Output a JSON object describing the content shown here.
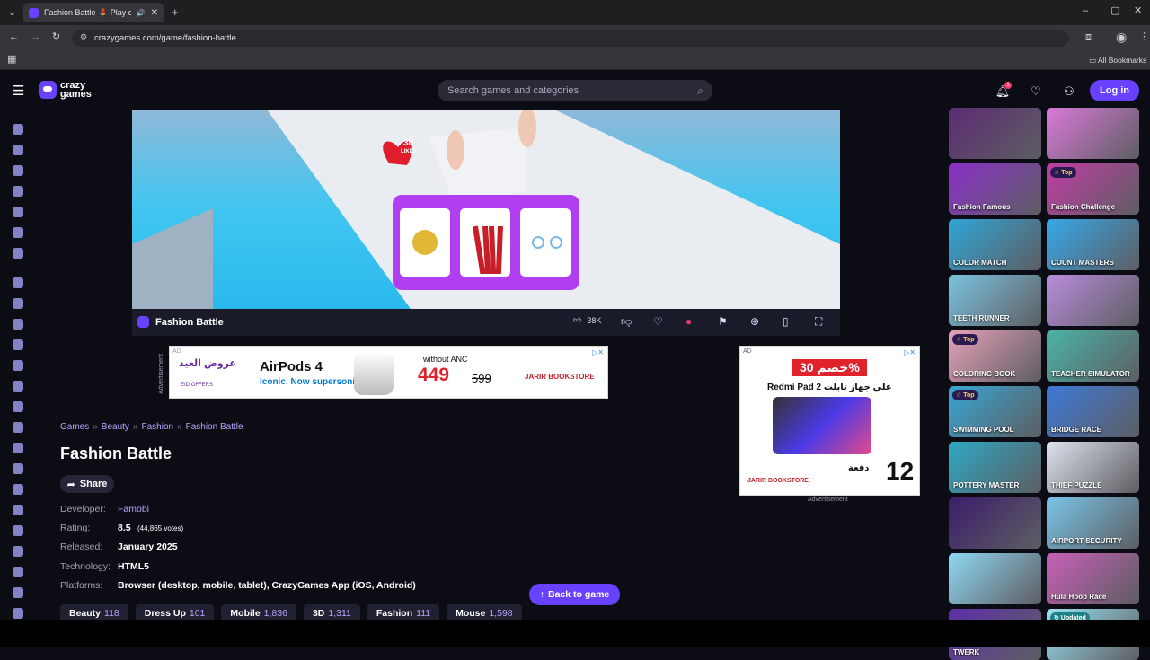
{
  "browser": {
    "tab_title": "Fashion Battle 💄 Play on C",
    "url": "crazygames.com/game/fashion-battle",
    "bookmarks_label": "All Bookmarks"
  },
  "site": {
    "logo_text_1": "crazy",
    "logo_text_2": "games",
    "search_placeholder": "Search games and categories",
    "login_label": "Log in",
    "notification_count": "1"
  },
  "game": {
    "name": "Fashion Battle",
    "likes_bubble": "38",
    "likes_bubble_label": "LIKES",
    "like_count": "38K"
  },
  "ads": {
    "ad_label": "AD",
    "ad1": {
      "brand": "AirPods 4",
      "tag": "Iconic. Now supersonic.",
      "note": "without ANC",
      "price": "449",
      "old_price": "599",
      "store": "JARIR BOOKSTORE",
      "side": "Advertisement",
      "arabic": "عروض العيد",
      "eid": "EID OFFERS"
    },
    "ad2": {
      "discount": "خصم 30%",
      "product": "Redmi Pad 2 على جهاز تابلت",
      "installments": "12",
      "installments_text": "دفعة",
      "store": "JARIR BOOKSTORE",
      "caption": "Advertisement"
    }
  },
  "details": {
    "breadcrumb": [
      "Games",
      "Beauty",
      "Fashion",
      "Fashion Battle"
    ],
    "title": "Fashion Battle",
    "share_label": "Share",
    "developer_label": "Developer:",
    "developer": "Famobi",
    "rating_label": "Rating:",
    "rating": "8.5",
    "votes": "(44,865 votes)",
    "released_label": "Released:",
    "released": "January 2025",
    "technology_label": "Technology:",
    "technology": "HTML5",
    "platforms_label": "Platforms:",
    "platforms": "Browser (desktop, mobile, tablet), CrazyGames App (iOS, Android)",
    "back_label": "Back to game"
  },
  "tags": [
    {
      "name": "Beauty",
      "count": "118"
    },
    {
      "name": "Dress Up",
      "count": "101"
    },
    {
      "name": "Mobile",
      "count": "1,836"
    },
    {
      "name": "3D",
      "count": "1,311"
    },
    {
      "name": "Fashion",
      "count": "111"
    },
    {
      "name": "Mouse",
      "count": "1,598"
    }
  ],
  "thumbnails": [
    {
      "label": "",
      "color": "#5b2b73",
      "badge": ""
    },
    {
      "label": "",
      "color": "#d97ad9",
      "badge": ""
    },
    {
      "label": "Fashion Famous",
      "color": "#8b2fc9",
      "badge": ""
    },
    {
      "label": "Fashion Challenge",
      "color": "#c23ca5",
      "badge": "Top"
    },
    {
      "label": "COLOR MATCH",
      "color": "#2fa5d8",
      "badge": ""
    },
    {
      "label": "COUNT MASTERS",
      "color": "#37a8ea",
      "badge": ""
    },
    {
      "label": "TEETH RUNNER",
      "color": "#7bc3e0",
      "badge": ""
    },
    {
      "label": "",
      "color": "#b98cdc",
      "badge": ""
    },
    {
      "label": "COLORING BOOK",
      "color": "#e7a1b9",
      "badge": "Top"
    },
    {
      "label": "TEACHER SIMULATOR",
      "color": "#4bb3a6",
      "badge": ""
    },
    {
      "label": "SWIMMING POOL",
      "color": "#38a6d5",
      "badge": "Top"
    },
    {
      "label": "BRIDGE RACE",
      "color": "#3d79d9",
      "badge": ""
    },
    {
      "label": "POTTERY MASTER",
      "color": "#2ea8c4",
      "badge": ""
    },
    {
      "label": "THIEF PUZZLE",
      "color": "#dde3ee",
      "badge": ""
    },
    {
      "label": "",
      "color": "#3b1d6b",
      "badge": ""
    },
    {
      "label": "AIRPORT SECURITY",
      "color": "#7ac4e8",
      "badge": ""
    },
    {
      "label": "",
      "color": "#8fd7f3",
      "badge": ""
    },
    {
      "label": "Hula Hoop Race",
      "color": "#c85fb8",
      "badge": ""
    },
    {
      "label": "TWERK",
      "color": "#5d2fa8",
      "badge": ""
    },
    {
      "label": "",
      "color": "#9be2f2",
      "badge": "Updated"
    }
  ],
  "colors": {
    "accent": "#6842ff",
    "background": "#0c0d14"
  }
}
